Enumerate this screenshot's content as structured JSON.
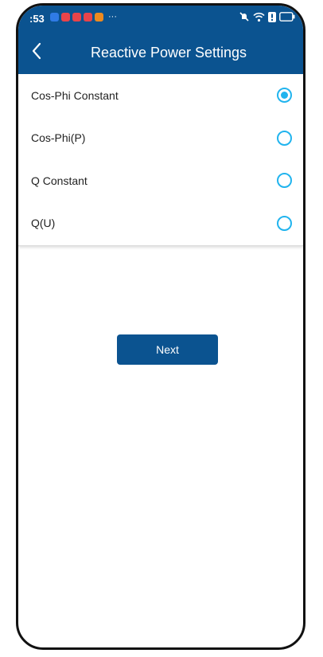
{
  "status_bar": {
    "time": ":53",
    "notification_icons": [
      {
        "name": "chat-app-icon",
        "color": "#2f7be6"
      },
      {
        "name": "mail-app-icon",
        "color": "#e8444a"
      },
      {
        "name": "mail-app-icon",
        "color": "#e8444a"
      },
      {
        "name": "message-app-icon",
        "color": "#e8444a"
      },
      {
        "name": "shop-app-icon",
        "color": "#ee8a1f"
      }
    ],
    "more_indicator": "···",
    "system_icons": [
      "mute-icon",
      "wifi-icon",
      "alert-icon",
      "battery-icon"
    ]
  },
  "app_bar": {
    "title": "Reactive Power Settings",
    "back_icon": "chevron-left-icon"
  },
  "options": [
    {
      "label": "Cos-Phi Constant",
      "selected": true
    },
    {
      "label": "Cos-Phi(P)",
      "selected": false
    },
    {
      "label": "Q Constant",
      "selected": false
    },
    {
      "label": "Q(U)",
      "selected": false
    }
  ],
  "actions": {
    "next_label": "Next"
  },
  "colors": {
    "primary": "#0b5390",
    "radio_accent": "#21b4ee"
  }
}
